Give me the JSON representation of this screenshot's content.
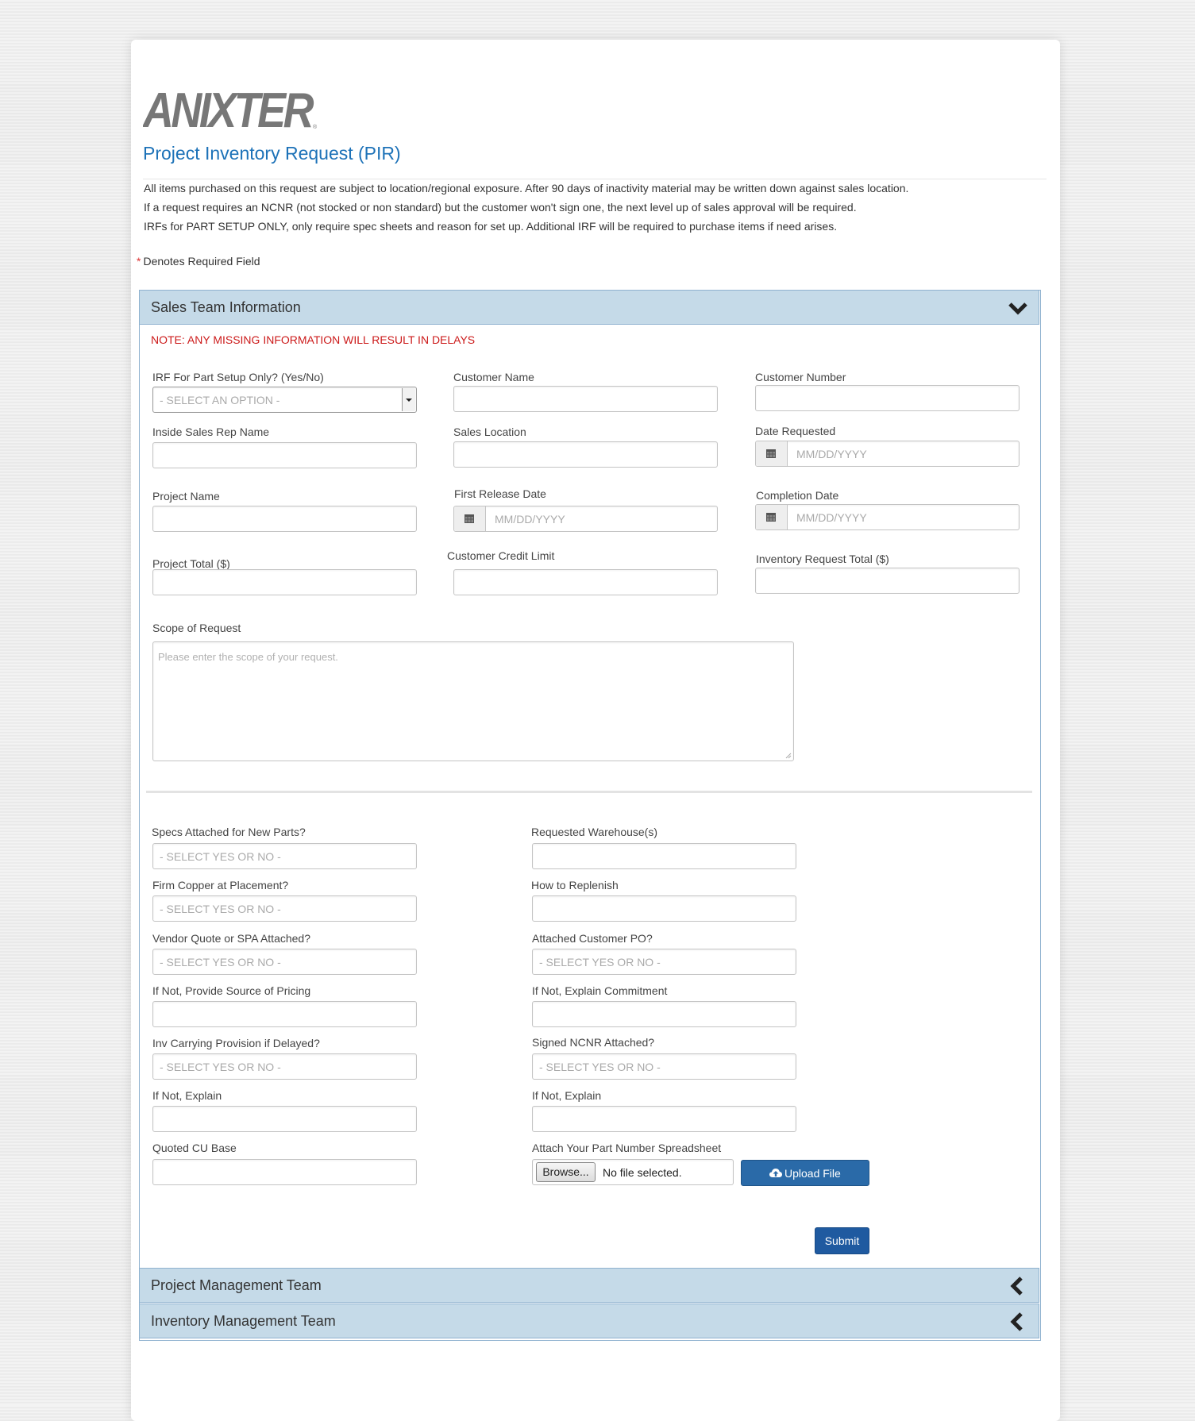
{
  "brand": {
    "logo_text": "ANIXTER",
    "logo_color": "#777777"
  },
  "page": {
    "title": "Project Inventory Request (PIR)",
    "intro": [
      "All items purchased on this request are subject to location/regional exposure.  After 90 days of inactivity material may be written down against sales location.",
      "If a request requires an NCNR (not stocked or non standard) but the customer won't sign one, the next level up of sales approval will be required.",
      "IRFs for PART SETUP ONLY, only require spec sheets and reason for set up.  Additional IRF will be required to purchase items if need arises."
    ],
    "required_star": "*",
    "required_note": "Denotes Required Field"
  },
  "colors": {
    "accent": "#1d72b8",
    "warning": "#cc1a1a",
    "panel_header": "#c5dae8",
    "button": "#2a6aa8"
  },
  "sales_panel": {
    "title": "Sales Team Information",
    "toggle_icon": "chevron-down-icon",
    "warning": "NOTE: ANY MISSING INFORMATION WILL RESULT IN DELAYS",
    "fields": {
      "irf_setup": {
        "label": "IRF For Part Setup Only? (Yes/No)",
        "placeholder": "- SELECT AN OPTION -"
      },
      "customer_name": {
        "label": "Customer Name",
        "value": ""
      },
      "customer_number": {
        "label": "Customer Number",
        "value": ""
      },
      "inside_sales_rep": {
        "label": "Inside Sales Rep Name",
        "value": ""
      },
      "sales_location": {
        "label": "Sales Location",
        "value": ""
      },
      "date_requested": {
        "label": "Date Requested",
        "placeholder": "MM/DD/YYYY"
      },
      "project_name": {
        "label": "Project Name",
        "value": ""
      },
      "first_release_date": {
        "label": "First Release Date",
        "placeholder": "MM/DD/YYYY"
      },
      "completion_date": {
        "label": "Completion Date",
        "placeholder": "MM/DD/YYYY"
      },
      "project_total": {
        "label": "Project Total ($)",
        "value": ""
      },
      "customer_credit_limit": {
        "label": "Customer Credit Limit",
        "value": ""
      },
      "inventory_request_total": {
        "label": "Inventory Request Total ($)",
        "value": ""
      },
      "scope": {
        "label": "Scope of Request",
        "placeholder": "Please enter the scope of your request."
      },
      "specs_attached": {
        "label": "Specs Attached for New Parts?",
        "placeholder": "- SELECT YES OR  NO -"
      },
      "requested_warehouses": {
        "label": "Requested Warehouse(s)",
        "value": ""
      },
      "firm_copper": {
        "label": "Firm Copper at Placement?",
        "placeholder": "- SELECT YES OR  NO -"
      },
      "how_to_replenish": {
        "label": "How to Replenish",
        "value": ""
      },
      "vendor_quote": {
        "label": "Vendor Quote or SPA Attached?",
        "placeholder": "- SELECT YES OR  NO -"
      },
      "attached_customer_po": {
        "label": "Attached Customer PO?",
        "placeholder": "- SELECT YES OR  NO -"
      },
      "source_of_pricing": {
        "label": "If Not, Provide Source of Pricing",
        "value": ""
      },
      "explain_commitment": {
        "label": "If Not, Explain Commitment",
        "value": ""
      },
      "inv_carrying": {
        "label": "Inv Carrying Provision if Delayed?",
        "placeholder": "- SELECT YES OR  NO -"
      },
      "signed_ncnr": {
        "label": "Signed NCNR Attached?",
        "placeholder": "- SELECT YES OR  NO -"
      },
      "if_not_explain_left": {
        "label": "If Not, Explain",
        "value": ""
      },
      "if_not_explain_right": {
        "label": "If Not, Explain",
        "value": ""
      },
      "quoted_cu_base": {
        "label": "Quoted CU Base",
        "value": ""
      },
      "attach_spreadsheet": {
        "label": "Attach Your Part Number Spreadsheet",
        "browse_label": "Browse...",
        "file_status": "No file selected."
      }
    },
    "upload_label": "Upload File",
    "submit_label": "Submit"
  },
  "collapsed_panels": [
    {
      "title": "Project Management Team",
      "icon": "chevron-left-icon"
    },
    {
      "title": "Inventory Management Team",
      "icon": "chevron-left-icon"
    }
  ]
}
